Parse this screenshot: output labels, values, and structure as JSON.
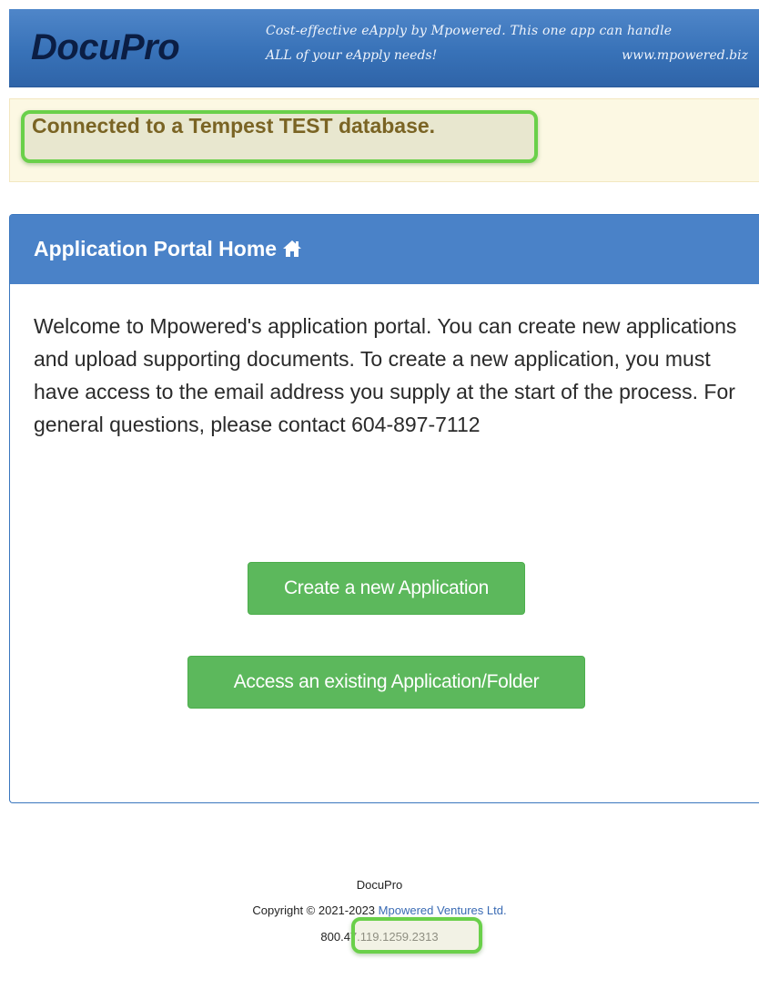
{
  "header": {
    "brand": "DocuPro",
    "tagline_line1": "Cost-effective eApply by Mpowered. This one app can handle",
    "tagline_line2": "ALL of your eApply needs!",
    "website": "www.mpowered.biz"
  },
  "alert": {
    "message": "Connected to a Tempest TEST database."
  },
  "panel": {
    "title": "Application Portal Home",
    "title_icon": "home-icon",
    "body": "Welcome to Mpowered's application portal. You can create new applications and upload supporting documents. To create a new application, you must have access to the email address you supply at the start of the process. For general questions, please contact 604-897-7112",
    "create_button_label": "Create a new Application",
    "access_button_label": "Access an existing Application/Folder"
  },
  "footer": {
    "app_name": "DocuPro",
    "copyright_prefix": "Copyright © 2021-2023 ",
    "company_link": "Mpowered Ventures Ltd.",
    "version": "800.47.119.1259.2313"
  },
  "colors": {
    "header_blue": "#3872b8",
    "panel_blue": "#4a82c8",
    "button_green": "#5cb85c",
    "alert_bg": "#fcf8e3",
    "highlight_green": "#6ad04a"
  }
}
